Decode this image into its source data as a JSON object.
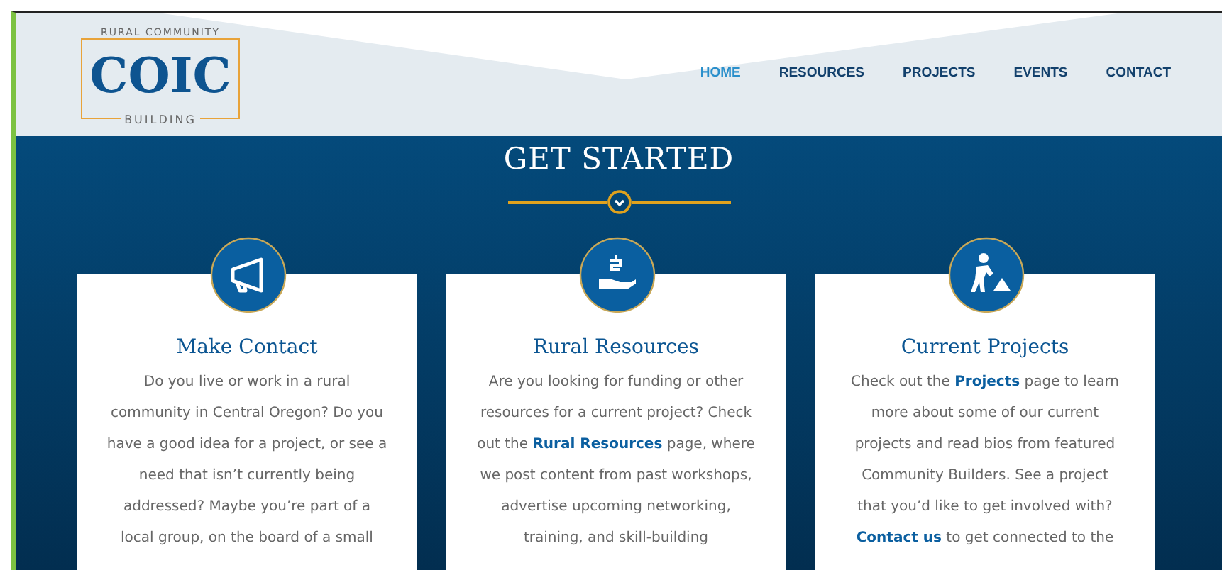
{
  "logo": {
    "top_text": "RURAL COMMUNITY",
    "main_text": "COIC",
    "bottom_text": "BUILDING"
  },
  "nav": [
    {
      "label": "HOME",
      "selected": true
    },
    {
      "label": "RESOURCES",
      "selected": false
    },
    {
      "label": "PROJECTS",
      "selected": false
    },
    {
      "label": "EVENTS",
      "selected": false
    },
    {
      "label": "CONTACT",
      "selected": false
    }
  ],
  "section": {
    "title": "GET STARTED"
  },
  "cards": [
    {
      "title": "Make Contact",
      "lines": [
        [
          {
            "text": "Do you live or work in a rural"
          }
        ],
        [
          {
            "text": "community in Central Oregon? Do you"
          }
        ],
        [
          {
            "text": "have a good idea for a project, or see a"
          }
        ],
        [
          {
            "text": "need that isn’t currently being"
          }
        ],
        [
          {
            "text": "addressed? Maybe you’re part of a"
          }
        ],
        [
          {
            "text": "local group, on the board of a small"
          }
        ]
      ]
    },
    {
      "title": "Rural Resources",
      "lines": [
        [
          {
            "text": "Are you looking for funding or other"
          }
        ],
        [
          {
            "text": "resources for a current project? Check"
          }
        ],
        [
          {
            "text": "out the "
          },
          {
            "text": "Rural Resources",
            "link": true
          },
          {
            "text": " page, where"
          }
        ],
        [
          {
            "text": "we post content from past workshops,"
          }
        ],
        [
          {
            "text": "advertise upcoming networking,"
          }
        ],
        [
          {
            "text": "training, and skill-building"
          }
        ]
      ]
    },
    {
      "title": "Current Projects",
      "lines": [
        [
          {
            "text": "Check out the "
          },
          {
            "text": "Projects",
            "link": true
          },
          {
            "text": " page to learn"
          }
        ],
        [
          {
            "text": "more about some of our current"
          }
        ],
        [
          {
            "text": "projects and read bios from featured"
          }
        ],
        [
          {
            "text": "Community Builders. See a project"
          }
        ],
        [
          {
            "text": "that you’d like to get involved with?"
          }
        ],
        [
          {
            "text": "Contact us",
            "link": true
          },
          {
            "text": " to get connected to the"
          }
        ]
      ]
    }
  ]
}
